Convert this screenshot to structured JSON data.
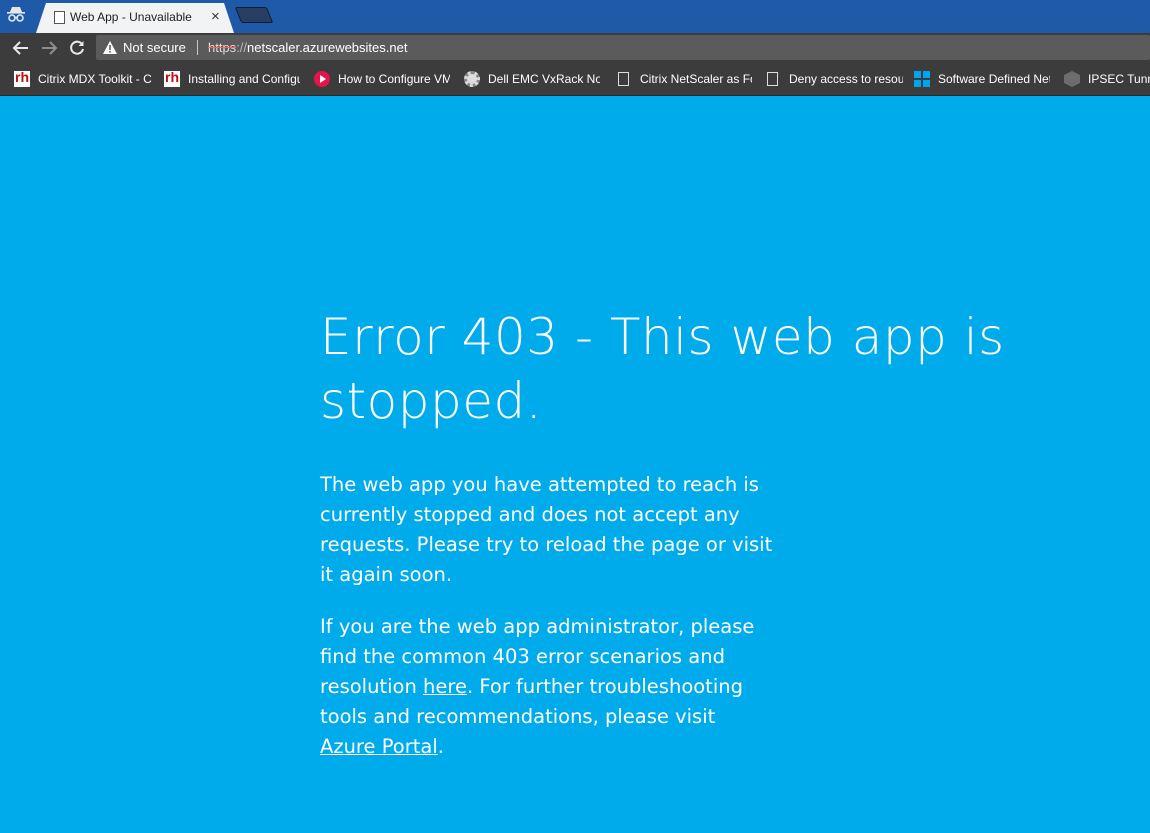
{
  "browser": {
    "tab": {
      "title": "Web App - Unavailable",
      "close_glyph": "×"
    },
    "toolbar": {
      "security_label": "Not secure",
      "url_scheme": "https",
      "url_separator": "://",
      "url_host": "netscaler.azurewebsites.net"
    },
    "bookmarks": [
      {
        "label": "Citrix MDX Toolkit - C",
        "icon": "rh-icon"
      },
      {
        "label": "Installing and Configu",
        "icon": "rh-icon"
      },
      {
        "label": "How to Configure VM",
        "icon": "play-circle-icon"
      },
      {
        "label": "Dell EMC VxRack Noc",
        "icon": "gear-icon"
      },
      {
        "label": "Citrix NetScaler as Fo",
        "icon": "page-icon"
      },
      {
        "label": "Deny access to resou",
        "icon": "page-icon"
      },
      {
        "label": "Software Defined Net",
        "icon": "windows-icon"
      },
      {
        "label": "IPSEC Tunne",
        "icon": "cube-icon"
      }
    ]
  },
  "page": {
    "heading": "Error 403 - This web app is stopped.",
    "paragraph1": "The web app you have attempted to reach is currently stopped and does not accept any requests. Please try to reload the page or visit it again soon.",
    "paragraph2": {
      "part1": "If you are the web app administrator, please find the common 403 error scenarios and resolution ",
      "link1": "here",
      "part2": ". For further troubleshooting tools and recommendations, please visit ",
      "link2": "Azure Portal",
      "part3": "."
    }
  },
  "colors": {
    "page_background": "#00abec",
    "tabstrip": "#1e5aa8",
    "toolbar": "#3c3c3c",
    "omnibox": "#5b5b5b",
    "text": "#ffffff"
  }
}
